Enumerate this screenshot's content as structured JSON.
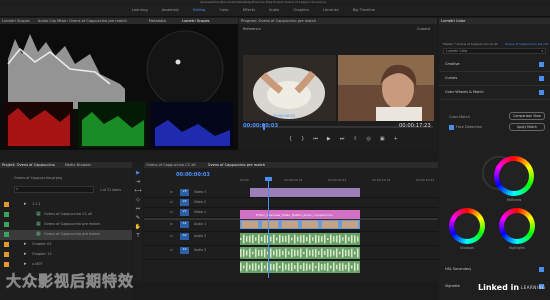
{
  "app": {
    "window_title": "/Users/admin/Documents/Desktop/Exercise Files Project Ovens of Cappuccino.prproj"
  },
  "workspaces": [
    "Learning",
    "Assembly",
    "Editing",
    "Color",
    "Effects",
    "Audio",
    "Graphics",
    "Libraries",
    "Big Timeline"
  ],
  "active_workspace": "Editing",
  "scopes": {
    "tab1": "Lumetri Scopes",
    "tab2": "Audio Clip Mixer: Ovens of Cappuccino pre match",
    "tab3": "Metadata",
    "tab4": "Lumetri Scopes"
  },
  "program": {
    "title": "Program: Ovens of Cappuccino pre match",
    "ref_label": "Reference",
    "cur_label": "Current",
    "tc_left": "00:00:00:03",
    "tc_mid": "00:00:00:03",
    "tc_right": "00:00:17:23"
  },
  "project": {
    "tab": "Project: Ovens of Cappuccino",
    "tab2": "Media Browser",
    "path": "Ovens of Cappuccino.prproj",
    "count": "1 of 21 items",
    "items": [
      {
        "name": "1.1.1",
        "type": "bin",
        "color": "#e09a2e",
        "indent": 0
      },
      {
        "name": "Ovens of Cappuccino CC all",
        "type": "seq",
        "color": "#3aa35c",
        "indent": 1
      },
      {
        "name": "Ovens of Cappuccino pre match",
        "type": "seq",
        "color": "#3aa35c",
        "indent": 1
      },
      {
        "name": "Ovens of Cappuccino pre match",
        "type": "seq",
        "color": "#3aa35c",
        "indent": 1
      },
      {
        "name": "Chapter 02",
        "type": "bin",
        "color": "#e09a2e",
        "indent": 0
      },
      {
        "name": "Chapter 13",
        "type": "bin",
        "color": "#e09a2e",
        "indent": 0
      },
      {
        "name": "z-NOT",
        "type": "bin",
        "color": "#e09a2e",
        "indent": 0
      }
    ]
  },
  "timeline": {
    "tab1": "Ovens of Cappuccino CC all",
    "tab2": "Ovens of Cappuccino pre match",
    "tc": "00:00:00:03",
    "ruler": [
      "00:00",
      "00:00:04:23",
      "00:00:09:23",
      "00:00:14:23",
      "00:00:19:23"
    ],
    "video_tracks": [
      "V3",
      "V2",
      "V1"
    ],
    "audio_tracks": [
      "A1",
      "A2",
      "A3"
    ],
    "video_track_names": [
      "Video 3",
      "Video 2",
      "Video 1"
    ],
    "audio_track_names": [
      "Audio 1",
      "Audio 2",
      "Audio 3"
    ],
    "clip_label": "Editor_Interview_Video_Hatton_audio_cropped.mov"
  },
  "lumetri": {
    "title": "Lumetri Color",
    "master": "Master * Ovens of Cappuccino CC all",
    "seq": "Ovens of Cappuccino pre match",
    "mode": "Lumetri Color",
    "sections": [
      "Creative",
      "Curves",
      "Color Wheels & Match",
      "HSL Secondary",
      "Vignette"
    ],
    "comparison_btn": "Comparison View",
    "face_detection": "Face Detection",
    "apply_match": "Apply Match",
    "color_match": "Color Match",
    "wheels": {
      "midtones": "Midtones",
      "shadows": "Shadows",
      "highlights": "Highlights"
    }
  },
  "watermark": {
    "cn": "大众影视后期特效",
    "brand": "Linked in",
    "learning": "LEARNING"
  }
}
